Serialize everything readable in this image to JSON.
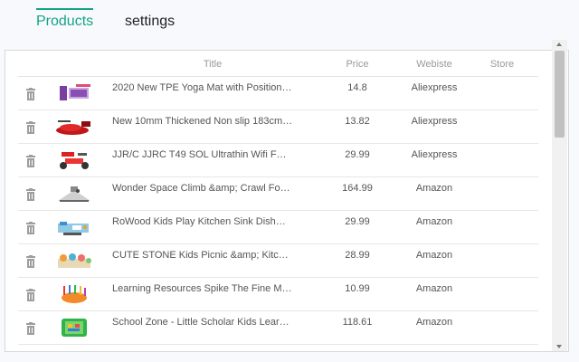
{
  "tabs": [
    {
      "label": "Products"
    },
    {
      "label": "settings"
    }
  ],
  "table": {
    "headers": {
      "title": "Title",
      "price": "Price",
      "website": "Webiste",
      "store": "Store"
    },
    "rows": [
      {
        "title": "2020 New TPE Yoga Mat with Position…",
        "price": "14.8",
        "website": "Aliexpress",
        "store": "",
        "icon": "yoga-mat-thumbnail"
      },
      {
        "title": "New 10mm Thickened Non slip 183cm…",
        "price": "13.82",
        "website": "Aliexpress",
        "store": "",
        "icon": "yoga-mat-red-thumbnail"
      },
      {
        "title": "JJR/C JJRC T49 SOL Ultrathin Wifi F…",
        "price": "29.99",
        "website": "Aliexpress",
        "store": "",
        "icon": "drone-thumbnail"
      },
      {
        "title": "Wonder Space Climb &amp; Crawl Fo…",
        "price": "164.99",
        "website": "Amazon",
        "store": "",
        "icon": "crawl-toy-thumbnail"
      },
      {
        "title": "RoWood Kids Play Kitchen Sink Dish…",
        "price": "29.99",
        "website": "Amazon",
        "store": "",
        "icon": "play-kitchen-thumbnail"
      },
      {
        "title": "CUTE STONE Kids Picnic &amp; Kitc…",
        "price": "28.99",
        "website": "Amazon",
        "store": "",
        "icon": "picnic-toy-thumbnail"
      },
      {
        "title": "Learning Resources Spike The Fine M…",
        "price": "10.99",
        "website": "Amazon",
        "store": "",
        "icon": "spike-hedgehog-thumbnail"
      },
      {
        "title": "School Zone - Little Scholar Kids Lear…",
        "price": "118.61",
        "website": "Amazon",
        "store": "",
        "icon": "kids-tablet-thumbnail"
      }
    ]
  },
  "colors": {
    "accent": "#16a389"
  }
}
